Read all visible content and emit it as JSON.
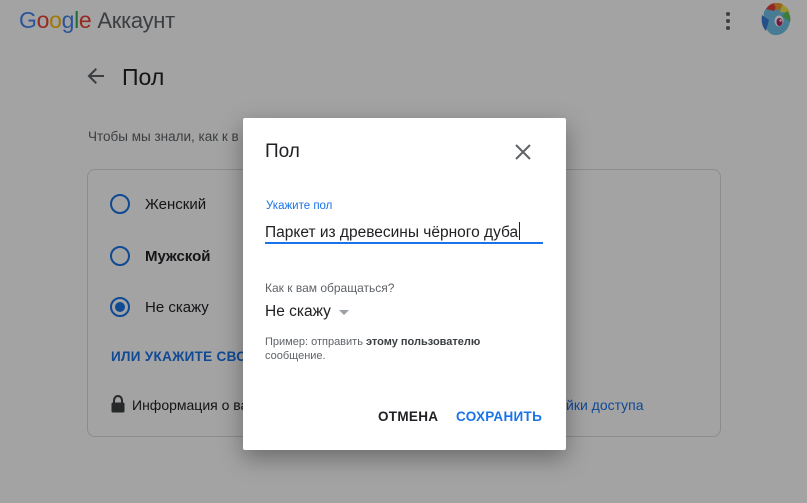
{
  "header": {
    "logo": {
      "letters": [
        "G",
        "o",
        "o",
        "g",
        "l",
        "e"
      ],
      "colors": [
        "#4285f4",
        "#ea4335",
        "#fbbc05",
        "#4285f4",
        "#34a853",
        "#ea4335"
      ]
    },
    "product": "Аккаунт",
    "menu_icon": "kebab-menu-icon",
    "avatar_icon": "pony-avatar-icon"
  },
  "page": {
    "title": "Пол",
    "intro": "Чтобы мы знали, как к в",
    "options": [
      {
        "label": "Женский",
        "selected": false
      },
      {
        "label": "Мужской",
        "selected": false
      },
      {
        "label": "Не скажу",
        "selected": true
      }
    ],
    "custom_link": "ИЛИ УКАЖИТЕ СВОЙ",
    "info_text": "Информация о ва",
    "access_link": "йки доступа"
  },
  "dialog": {
    "title": "Пол",
    "field_label": "Укажите пол",
    "field_value": "Паркет из древесины чёрного дуба",
    "question": "Как к вам обращаться?",
    "select_value": "Не скажу",
    "example_prefix": "Пример: отправить ",
    "example_bold": "этому пользователю",
    "example_suffix": "сообщение.",
    "cancel_label": "ОТМЕНА",
    "save_label": "СОХРАНИТЬ"
  },
  "colors": {
    "accent": "#1a73e8",
    "scrim": "rgba(0,0,0,0.36)"
  }
}
